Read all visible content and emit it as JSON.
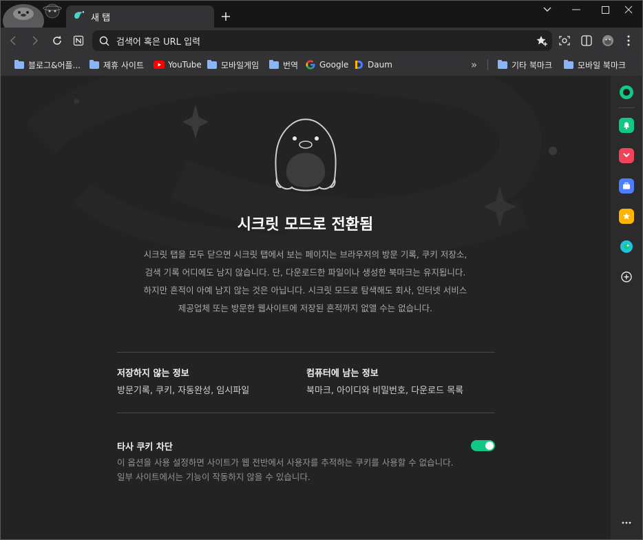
{
  "tab": {
    "title": "새 탭",
    "icon": "whale-icon"
  },
  "toolbar": {
    "omnibox_placeholder": "검색어 혹은 URL 입력"
  },
  "bookmarks": {
    "items": [
      {
        "label": "블로그&어플...",
        "icon": "folder-icon"
      },
      {
        "label": "제휴 사이트",
        "icon": "folder-icon"
      },
      {
        "label": "YouTube",
        "icon": "youtube-icon"
      },
      {
        "label": "모바일게임",
        "icon": "folder-icon"
      },
      {
        "label": "번역",
        "icon": "folder-icon"
      },
      {
        "label": "Google",
        "icon": "google-icon"
      },
      {
        "label": "Daum",
        "icon": "daum-icon"
      }
    ],
    "overflow": "»",
    "other": "기타 북마크",
    "mobile": "모바일 북마크"
  },
  "incognito": {
    "heading": "시크릿 모드로 전환됨",
    "description_lines": [
      "시크릿 탭을 모두 닫으면 시크릿 탭에서 보는 페이지는 브라우저의 방문 기록, 쿠키 저장소,",
      "검색 기록 어디에도 남지 않습니다. 단, 다운로드한 파일이나 생성한 북마크는 유지됩니다.",
      "하지만 흔적이 아예 남지 않는 것은 아닙니다. 시크릿 모드로 탐색해도 회사, 인터넷 서비스",
      "제공업체 또는 방문한 웹사이트에 저장된 흔적까지 없앨 수는 없습니다."
    ],
    "not_saved_title": "저장하지 않는 정보",
    "not_saved_items": "방문기록, 쿠키, 자동완성, 임시파일",
    "saved_title": "컴퓨터에 남는 정보",
    "saved_items": "북마크, 아이디와 비밀번호, 다운로드 목록",
    "cookie_title": "타사 쿠키 차단",
    "cookie_toggle_on": true,
    "cookie_desc_lines": [
      "이 옵션을 사용 설정하면 사이트가 웹 전반에서 사용자를 추적하는 쿠키를 사용할 수 없습니다.",
      "일부 사이트에서는 기능이 작동하지 않을 수 있습니다."
    ]
  },
  "colors": {
    "accent": "#12c885",
    "background": "#232324",
    "toolbar": "#333335"
  }
}
